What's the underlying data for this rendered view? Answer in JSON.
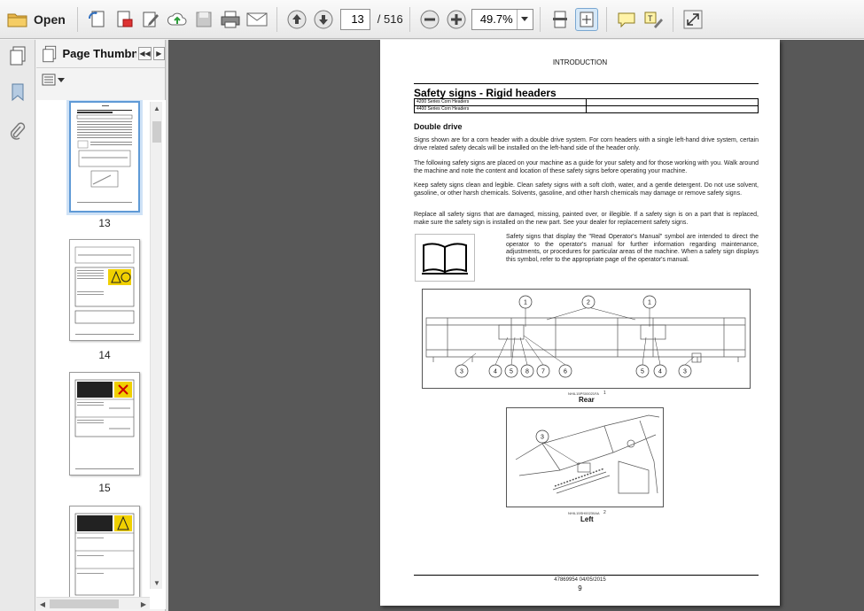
{
  "toolbar": {
    "open_label": "Open",
    "page_current": "13",
    "page_total": "/ 516",
    "zoom_value": "49.7%"
  },
  "thumbnails": {
    "panel_title": "Page Thumbna...",
    "pages": [
      "13",
      "14",
      "15"
    ]
  },
  "document": {
    "header": "INTRODUCTION",
    "title": "Safety signs - Rigid headers",
    "table_rows": [
      [
        "4200 Series Corn Headers",
        ""
      ],
      [
        "4400 Series Corn Headers",
        ""
      ]
    ],
    "subheading": "Double drive",
    "paragraphs": [
      "Signs shown are for a corn header with a double drive system. For corn headers with a single left-hand drive system, certain drive related safety decals will be installed on the left-hand side of the header only.",
      "The following safety signs are placed on your machine as a guide for your safety and for those working with you. Walk around the machine and note the content and location of these safety signs before operating your machine.",
      "Keep safety signs clean and legible. Clean safety signs with a soft cloth, water, and a gentle detergent. Do not use solvent, gasoline, or other harsh chemicals. Solvents, gasoline, and other harsh chemicals may damage or remove safety signs.",
      "Replace all safety signs that are damaged, missing, painted over, or illegible. If a safety sign is on a part that is replaced, make sure the safety sign is installed on the new part. See your dealer for replacement safety signs."
    ],
    "manual_note": "Safety signs that display the \"Read Operator's Manual\" symbol are intended to direct the operator to the operator's manual for further information regarding maintenance, adjustments, or procedures for particular areas of the machine. When a safety sign displays this symbol, refer to the appropriate page of the operator's manual.",
    "figure1": {
      "code": "NHIL15PS00021FA",
      "number": "1",
      "caption": "Rear",
      "callouts": [
        "1",
        "2",
        "1",
        "3",
        "4",
        "5",
        "8",
        "7",
        "6",
        "5",
        "4",
        "3"
      ]
    },
    "figure2": {
      "code": "NHIL15SH00230AA",
      "number": "2",
      "caption": "Left",
      "callouts": [
        "3"
      ]
    },
    "footer": "47869954 04/05/2015",
    "page_number": "9"
  }
}
